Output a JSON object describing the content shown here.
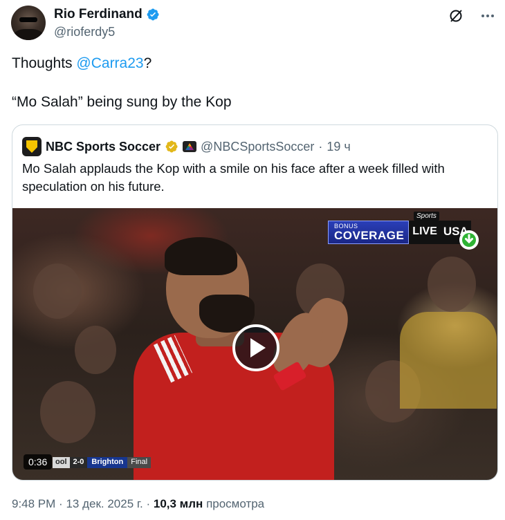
{
  "author": {
    "name": "Rio Ferdinand",
    "handle": "@rioferdy5"
  },
  "icons": {
    "verified": "verified-badge-icon",
    "grok": "grok-slash-icon",
    "more": "more-options-icon"
  },
  "tweet": {
    "line1_prefix": "Thoughts ",
    "line1_mention": "@Carra23",
    "line1_suffix": "?",
    "line2": "“Mo Salah” being sung by the Kop"
  },
  "quote": {
    "name": "NBC Sports Soccer",
    "handle": "@NBCSportsSoccer",
    "separator": "·",
    "time": "19 ч",
    "text": "Mo Salah applauds the Kop with a smile on his face after a week filled with speculation on his future."
  },
  "video": {
    "bug_small": "BONUS",
    "bug_big": "COVERAGE",
    "live": "LIVE",
    "network": "USA",
    "network_logo": "Sports",
    "duration": "0:36",
    "scoreboard": {
      "team1": "ool",
      "score": "2-0",
      "team2": "Brighton",
      "status": "Final"
    }
  },
  "meta": {
    "time": "9:48 PM",
    "sep1": "·",
    "date": "13 дек. 2025 г.",
    "sep2": "·",
    "views_count": "10,3 млн",
    "views_label": "просмотра"
  },
  "colors": {
    "link": "#1d9bf0",
    "secondary": "#536471",
    "verified_blue": "#1d9bf0",
    "verified_gold": "#e2b719"
  }
}
